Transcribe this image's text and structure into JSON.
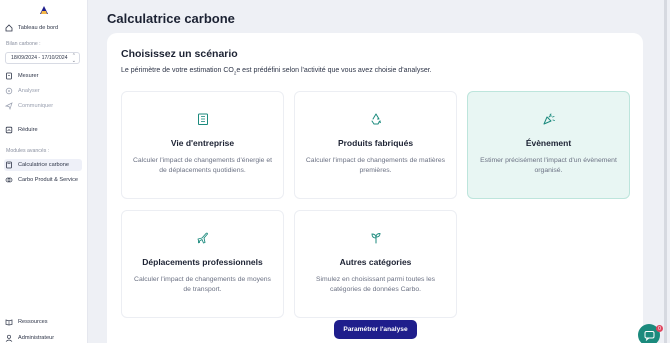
{
  "sidebar": {
    "logo": "carbo-logo",
    "dashboard": "Tableau de bord",
    "bilan_label": "Bilan carbone :",
    "bilan_value": "18/09/2024 - 17/10/2024",
    "items": [
      {
        "label": "Mesurer",
        "icon": "clipboard-icon",
        "state": "normal"
      },
      {
        "label": "Analyser",
        "icon": "analyze-icon",
        "state": "disabled"
      },
      {
        "label": "Communiquer",
        "icon": "send-icon",
        "state": "disabled"
      },
      {
        "label": "Réduire",
        "icon": "reduce-icon",
        "state": "normal"
      }
    ],
    "advanced_label": "Modules avancés :",
    "advanced_items": [
      {
        "label": "Calculatrice carbone",
        "icon": "calculator-icon",
        "state": "active"
      },
      {
        "label": "Carbo Produit & Service",
        "icon": "product-icon",
        "state": "normal"
      }
    ],
    "resources": "Ressources",
    "admin": "Administrateur"
  },
  "page": {
    "title": "Calculatrice carbone"
  },
  "panel": {
    "title": "Choisissez un scénario",
    "desc_before": "Le périmètre de votre estimation CO",
    "desc_sub": "2",
    "desc_after": "e est prédéfini selon l'activité que vous avez choisie d'analyser."
  },
  "cards": [
    {
      "title": "Vie d'entreprise",
      "desc": "Calculer l'impact de changements d'énergie et de déplacements quotidiens.",
      "icon": "building-icon",
      "selected": false
    },
    {
      "title": "Produits fabriqués",
      "desc": "Calculer l'impact de changements de matières premières.",
      "icon": "recycle-icon",
      "selected": false
    },
    {
      "title": "Évènement",
      "desc": "Estimer précisément l'impact d'un évènement organisé.",
      "icon": "party-popper-icon",
      "selected": true
    },
    {
      "title": "Déplacements professionnels",
      "desc": "Calculer l'impact de changements de moyens de transport.",
      "icon": "plane-icon",
      "selected": false
    },
    {
      "title": "Autres catégories",
      "desc": "Simulez en choisissant parmi toutes les catégories de données Carbo.",
      "icon": "sprout-icon",
      "selected": false
    }
  ],
  "cta_label": "Paramétrer l'analyse",
  "help_badge": "0",
  "colors": {
    "accent": "#1f1e8c",
    "teal": "#1b8a7d",
    "selected_bg": "#e8f6f3"
  }
}
